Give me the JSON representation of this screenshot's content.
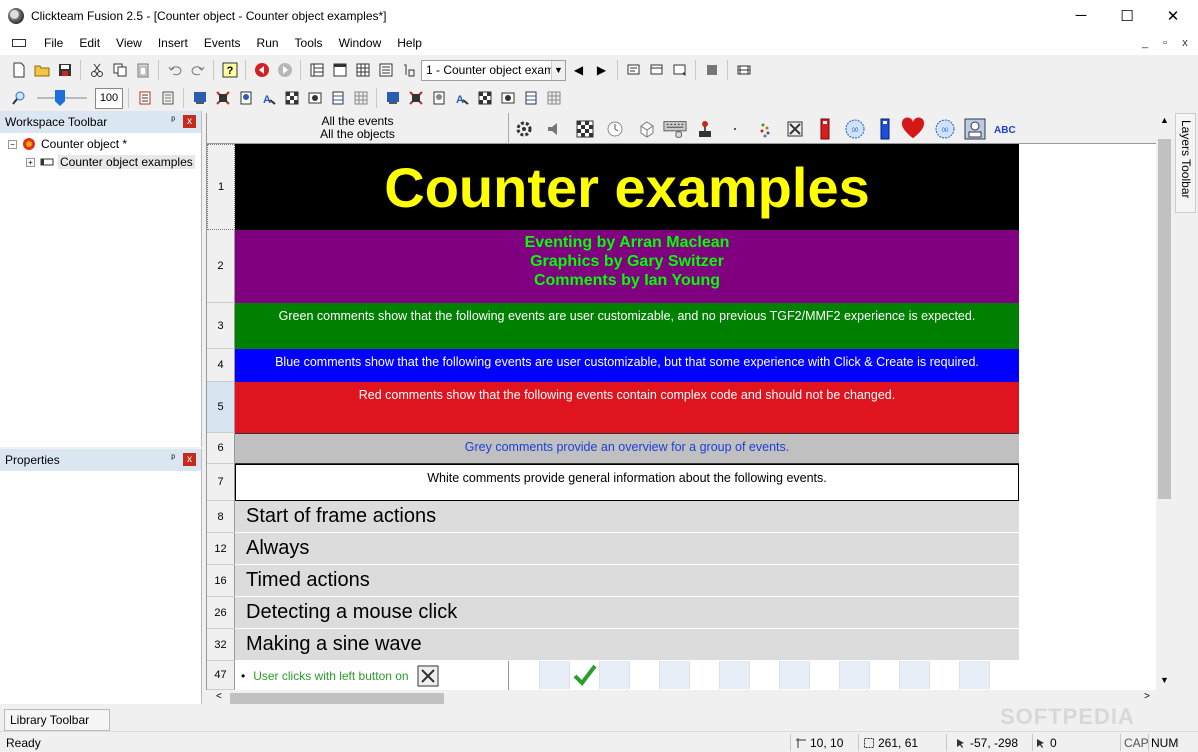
{
  "window": {
    "title": "Clickteam Fusion 2.5 - [Counter object - Counter object examples*]",
    "minimize": "─",
    "maximize": "☐",
    "close": "✕"
  },
  "menu": {
    "items": [
      "File",
      "Edit",
      "View",
      "Insert",
      "Events",
      "Run",
      "Tools",
      "Window",
      "Help"
    ],
    "mdi": [
      "_",
      "▫",
      "x"
    ]
  },
  "toolbar": {
    "frame_select": "1 - Counter object exam",
    "zoom": "100"
  },
  "workspace": {
    "title": "Workspace Toolbar",
    "pin": "ᵖ",
    "close": "x",
    "tree": [
      {
        "label": "Counter object *",
        "expander": "−"
      },
      {
        "label": "Counter object examples",
        "expander": "+"
      }
    ]
  },
  "properties": {
    "title": "Properties",
    "pin": "ᵖ",
    "close": "x"
  },
  "editor": {
    "header": {
      "line1": "All the events",
      "line2": "All the objects"
    },
    "rows": [
      {
        "num": "1",
        "text": "Counter examples"
      },
      {
        "num": "2",
        "lines": [
          "Eventing by Arran Maclean",
          "Graphics by Gary Switzer",
          "Comments by Ian Young"
        ]
      },
      {
        "num": "3",
        "text": "Green comments show that the following events are user customizable, and no previous TGF2/MMF2 experience is expected."
      },
      {
        "num": "4",
        "text": "Blue comments show that the following events are user customizable, but that some experience with Click & Create is required."
      },
      {
        "num": "5",
        "text": "Red comments show that the following events contain complex code and should not be changed."
      },
      {
        "num": "6",
        "text": "Grey comments provide an overview for a group of events."
      },
      {
        "num": "7",
        "text": "White comments provide general information about the following events."
      },
      {
        "num": "8",
        "text": "Start of frame actions"
      },
      {
        "num": "12",
        "text": "Always"
      },
      {
        "num": "16",
        "text": "Timed actions"
      },
      {
        "num": "26",
        "text": "Detecting a mouse click"
      },
      {
        "num": "32",
        "text": "Making a sine wave"
      },
      {
        "num": "47",
        "text": "User clicks with left button on",
        "bullet": "•"
      }
    ]
  },
  "layers_tab": "Layers Toolbar",
  "library_tab": "Library Toolbar",
  "status": {
    "ready": "Ready",
    "pos1": "10, 10",
    "pos2": "261, 61",
    "pos3": "-57, -298",
    "count": "0",
    "cap": "CAP",
    "num": "NUM"
  },
  "watermark": "SOFTPEDIA",
  "colors": {
    "title_bg": "#000000",
    "title_text": "#ffff00",
    "credits_bg": "#800080",
    "credits_text": "#00ff00",
    "green": "#008000",
    "blue": "#0000ff",
    "red": "#e0141e",
    "grey": "#c0c0c0",
    "group": "#dcdcdc",
    "accent": "#1e6fd9"
  }
}
